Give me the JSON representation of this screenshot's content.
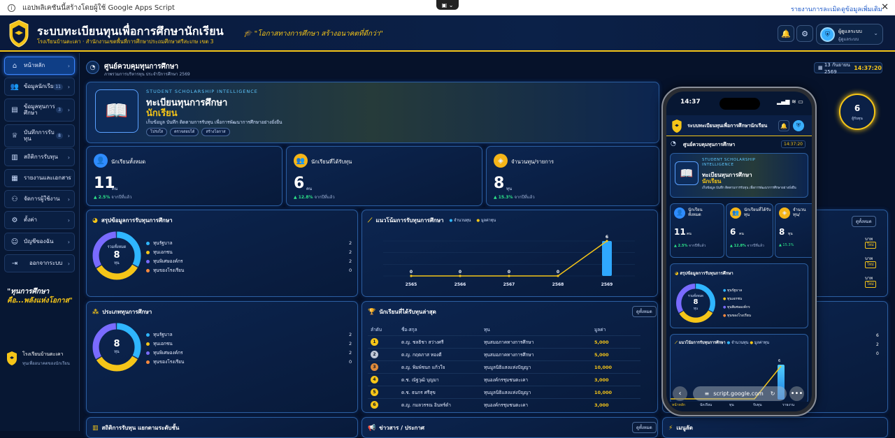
{
  "banner": {
    "info_icon": "info-icon",
    "notice": "แอปพลิเคชันนี้สร้างโดยผู้ใช้ Google Apps Script",
    "report_link": "รายงานการละเมิด",
    "more_link": "ดูข้อมูลเพิ่มเติม",
    "close": "✕",
    "ext_icon": "▣ ⌄"
  },
  "header": {
    "title": "ระบบทะเบียนทุนเพื่อการศึกษานักเรียน",
    "subtitle": "โรงเรียนบ้านตะเคา · สำนักงานเขตพื้นที่การศึกษาประถมศึกษาศรีสะเกษ เขต 3",
    "slogan": "\"โอกาสทางการศึกษา สร้างอนาคตที่ดีกว่า\"",
    "user_name": "ผู้ดูแลระบบ",
    "user_role": "ผู้ดูแลระบบ"
  },
  "sidebar": {
    "items": [
      {
        "icon": "⌂",
        "label": "หน้าหลัก",
        "badge": ""
      },
      {
        "icon": "👥",
        "label": "ข้อมูลนักเรียน",
        "badge": "11"
      },
      {
        "icon": "▤",
        "label": "ข้อมูลทุนการศึกษา",
        "badge": "3"
      },
      {
        "icon": "♕",
        "label": "บันทึกการรับทุน",
        "badge": "8"
      },
      {
        "icon": "▥",
        "label": "สถิติการรับทุน",
        "badge": ""
      },
      {
        "icon": "▦",
        "label": "รายงานและเอกสาร",
        "badge": ""
      },
      {
        "icon": "⚇",
        "label": "จัดการผู้ใช้งาน",
        "badge": ""
      },
      {
        "icon": "⚙",
        "label": "ตั้งค่า",
        "badge": ""
      },
      {
        "icon": "☺",
        "label": "บัญชีของฉัน",
        "badge": ""
      },
      {
        "icon": "⇥",
        "label": "ออกจากระบบ",
        "badge": ""
      }
    ],
    "quote_line1": "\"ทุนการศึกษา",
    "quote_line2": "คือ...พลังแห่งโอกาส\"",
    "school_name": "โรงเรียนบ้านตะเคา",
    "school_sub": "ทุนเพื่ออนาคตของนักเรียน"
  },
  "page": {
    "title": "ศูนย์ควบคุมทุนการศึกษา",
    "subtitle": "ภาพรวมการบริหารทุน ประจำปีการศึกษา 2569",
    "date": "13 กันยายน 2569",
    "time": "14:37:20"
  },
  "hero": {
    "tag": "STUDENT SCHOLARSHIP INTELLIGENCE",
    "line1": "ทะเบียนทุนการศึกษา",
    "line2": "นักเรียน",
    "desc": "เก็บข้อมูล บันทึก ติดตามการรับทุน เพื่อการพัฒนาการศึกษาอย่างยั่งยืน",
    "pills": [
      "โปร่งใส",
      "ตรวจสอบได้",
      "สร้างโอกาส"
    ],
    "ring_value": "6",
    "ring_label": "ผู้รับทุน"
  },
  "stats": [
    {
      "label": "นักเรียนทั้งหมด",
      "value": "11",
      "unit": "คน",
      "change": "▲ 2.5%",
      "change_note": "จากปีที่แล้ว",
      "color": "#2f8cff",
      "icon": "👤"
    },
    {
      "label": "นักเรียนที่ได้รับทุน",
      "value": "6",
      "unit": "คน",
      "change": "▲ 12.8%",
      "change_note": "จากปีที่แล้ว",
      "color": "#f5b518",
      "icon": "👥"
    },
    {
      "label": "จำนวนทุน/รายการ",
      "value": "8",
      "unit": "ทุน",
      "change": "▲ 15.3%",
      "change_note": "จากปีที่แล้ว",
      "color": "#f5b518",
      "icon": "◈"
    }
  ],
  "summary": {
    "title": "สรุปข้อมูลการรับทุนการศึกษา",
    "center_label": "รวมทั้งหมด",
    "center_value": "8",
    "center_unit": "ทุน",
    "legend": [
      {
        "name": "ทุนรัฐบาล",
        "value": "2",
        "color": "#2fb6ff"
      },
      {
        "name": "ทุนเอกชน",
        "value": "2",
        "color": "#f5c518"
      },
      {
        "name": "ทุนพิเศษองค์กร",
        "value": "2",
        "color": "#7a6bff"
      },
      {
        "name": "ทุนของโรงเรียน",
        "value": "0",
        "color": "#ff8a3d"
      }
    ]
  },
  "trend": {
    "title": "แนวโน้มการรับทุนการศึกษา",
    "legend_count": "จำนวนทุน",
    "legend_value": "มูลค่าทุน"
  },
  "chart_data": {
    "type": "bar",
    "title": "แนวโน้มการรับทุนการศึกษา",
    "categories": [
      "2565",
      "2566",
      "2567",
      "2568",
      "2569"
    ],
    "series": [
      {
        "name": "จำนวนทุน",
        "values": [
          0,
          0,
          0,
          0,
          6
        ]
      },
      {
        "name": "มูลค่าทุน",
        "values": [
          0,
          0,
          0,
          0,
          6
        ]
      }
    ],
    "ylim": [
      0,
      6
    ],
    "grid": true
  },
  "types": {
    "title": "ประเภททุนการศึกษา",
    "center_value": "8",
    "center_unit": "ทุน",
    "legend": [
      {
        "name": "ทุนรัฐบาล",
        "value": "2",
        "color": "#2fb6ff"
      },
      {
        "name": "ทุนเอกชน",
        "value": "2",
        "color": "#f5c518"
      },
      {
        "name": "ทุนพิเศษองค์กร",
        "value": "2",
        "color": "#7a6bff"
      },
      {
        "name": "ทุนของโรงเรียน",
        "value": "0",
        "color": "#ff8a3d"
      }
    ]
  },
  "latest": {
    "title": "นักเรียนที่ได้รับทุนล่าสุด",
    "view_all": "ดูทั้งหมด",
    "headers": [
      "ลำดับ",
      "ชื่อ-สกุล",
      "ทุน",
      "มูลค่า"
    ],
    "rows": [
      {
        "no": "1",
        "name": "ด.ญ. ชลธิชา สว่างศรี",
        "fund": "ทุนสมอภาคทางการศึกษา",
        "amount": "5,000",
        "color": "#f5c518"
      },
      {
        "no": "2",
        "name": "ด.ญ. กฤตภาส ทองดี",
        "fund": "ทุนสมอภาคทางการศึกษา",
        "amount": "5,000",
        "color": "#c0c8d8"
      },
      {
        "no": "3",
        "name": "ด.ญ. พิมพ์ชนก แก้วใจ",
        "fund": "ทุนมูลนิธิแสงแห่งปัญญา",
        "amount": "10,000",
        "color": "#e08a3a"
      },
      {
        "no": "4",
        "name": "ด.ช. ณัฐวุฒิ บุญมา",
        "fund": "ทุนองค์กรชุมชนตะเคา",
        "amount": "3,000",
        "color": "#f5c518"
      },
      {
        "no": "5",
        "name": "ด.ช. ธนกร ศรีสุข",
        "fund": "ทุนมูลนิธิแสงแห่งปัญญา",
        "amount": "10,000",
        "color": "#f5c518"
      },
      {
        "no": "6",
        "name": "ด.ญ. กมลวรรณ อินทร์ดำ",
        "fund": "ทุนองค์กรชุมชนตะเคา",
        "amount": "3,000",
        "color": "#f5c518"
      }
    ]
  },
  "right_col": {
    "view_all": "ดูทั้งหมด",
    "rows": [
      {
        "v": "บาท",
        "b": "ใหม่"
      },
      {
        "v": "บาท",
        "b": "ใหม่"
      },
      {
        "v": "บาท",
        "b": "ใหม่"
      }
    ],
    "values": [
      "6",
      "2",
      "0"
    ]
  },
  "bottom": {
    "stats_title": "สถิติการรับทุน แยกตามระดับชั้น",
    "news_title": "ข่าวสาร / ประกาศ",
    "news_btn": "ดูทั้งหมด",
    "menu_title": "เมนูลัด"
  },
  "phone": {
    "time": "14:37",
    "signal": "▂▄▆ ≋ ▭",
    "title": "ระบบทะเบียนทุนเพื่อการศึกษานักเรียน",
    "page_title": "ศูนย์ควบคุมทุนการศึกษา",
    "page_time": "14:37:20",
    "hero_tag": "STUDENT SCHOLARSHIP INTELLIGENCE",
    "hero_line1": "ทะเบียนทุนการศึกษา",
    "hero_line2": "นักเรียน",
    "hero_desc": "เก็บข้อมูล บันทึก ติดตามการรับทุน เพื่อการพัฒนาการศึกษาอย่างยั่งยืน",
    "stats": [
      {
        "label": "นักเรียนทั้งหมด",
        "value": "11",
        "unit": "คน",
        "change": "▲ 2.5%",
        "note": "จากปีที่แล้ว"
      },
      {
        "label": "นักเรียนที่ได้รับทุน",
        "value": "6",
        "unit": "คน",
        "change": "▲ 12.8%",
        "note": "จากปีที่แล้ว"
      },
      {
        "label": "จำนวนทุน/รายการ",
        "value": "8",
        "unit": "ทุน",
        "change": "▲ 15.3%",
        "note": ""
      }
    ],
    "summary_title": "สรุปข้อมูลการรับทุนการศึกษา",
    "summary_center_label": "รวมทั้งหมด",
    "summary_center_value": "8",
    "summary_center_unit": "ทุน",
    "summary_legend": [
      "ทุนรัฐบาล",
      "ทุนเอกชน",
      "ทุนพิเศษองค์กร",
      "ทุนของโรงเรียน"
    ],
    "trend_title": "แนวโน้มการรับทุนการศึกษา",
    "trend_legend_count": "จำนวนทุน",
    "trend_legend_value": "มูลค่าทุน",
    "trend_peak": "6",
    "url": "script.google.com",
    "bottom_nav": [
      "หน้าหลัก",
      "นักเรียน",
      "ทุน",
      "รับทุน",
      "รายงาน"
    ]
  }
}
